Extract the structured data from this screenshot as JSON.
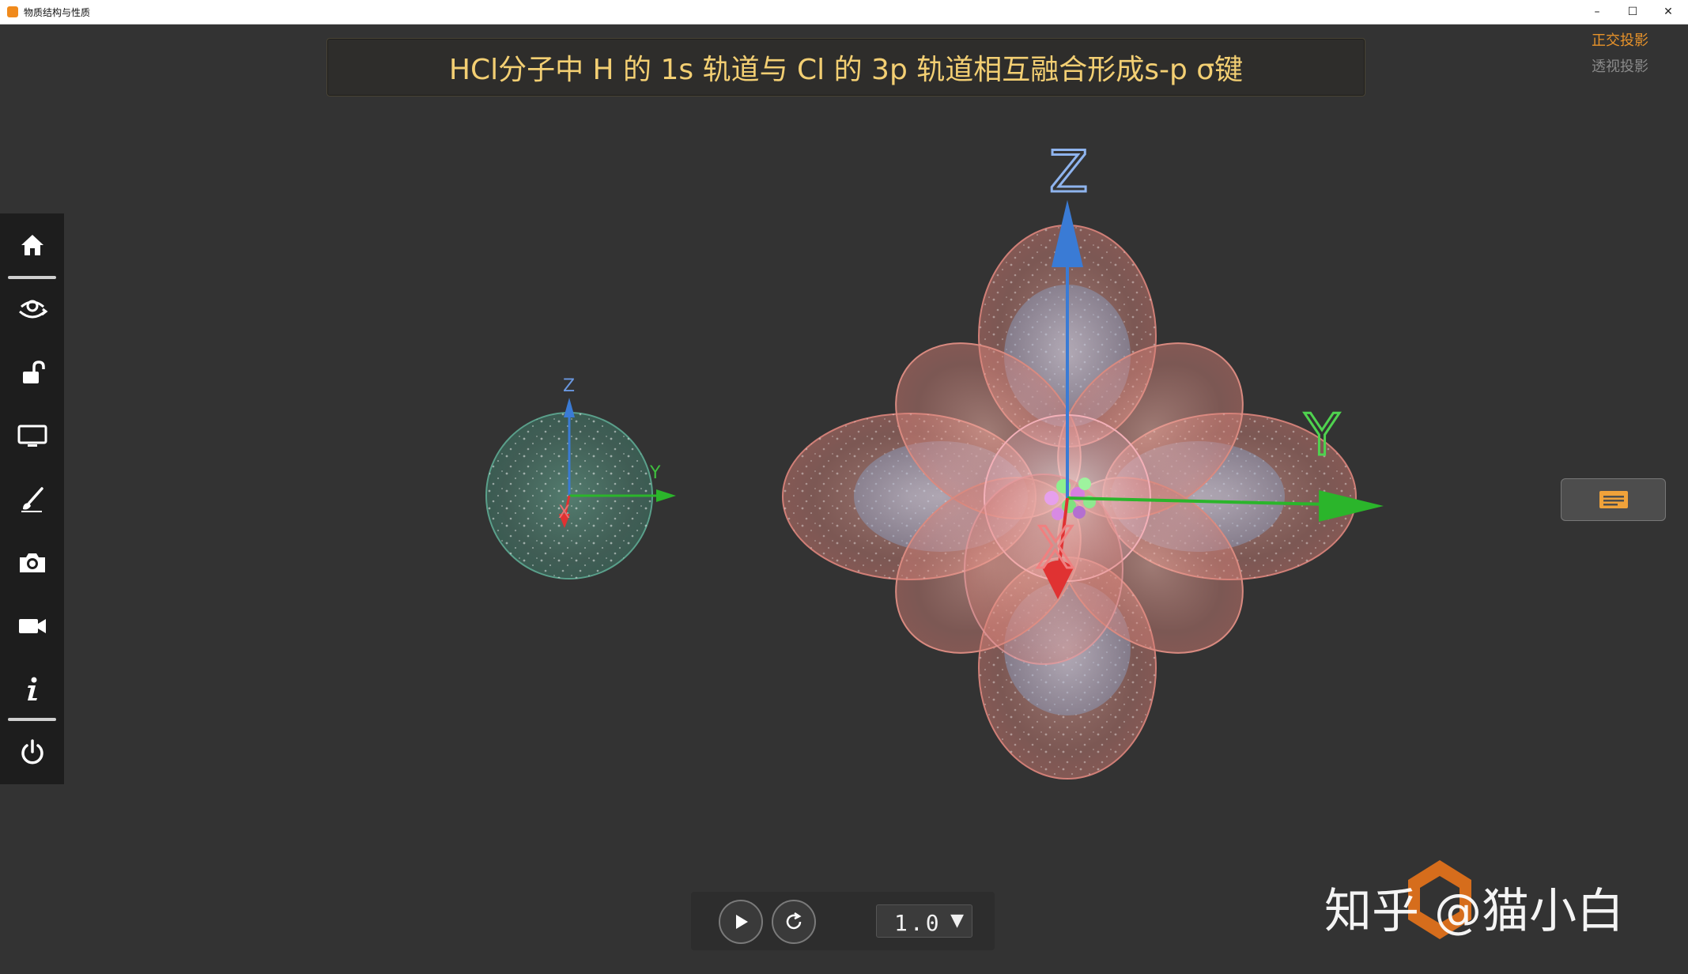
{
  "window": {
    "title": "物质结构与性质",
    "minimize_glyph": "–",
    "maximize_glyph": "☐",
    "close_glyph": "✕"
  },
  "banner": {
    "title": "HCl分子中 H 的 1s 轨道与 Cl 的 3p 轨道相互融合形成s-p σ键"
  },
  "projection": {
    "orthographic": "正交投影",
    "perspective": "透视投影",
    "active_color": "#e8932a",
    "inactive_color": "#8a8a8a"
  },
  "sidebar": {
    "items": [
      {
        "icon": "home-icon"
      },
      {
        "icon": "view-rotate-icon"
      },
      {
        "icon": "unlock-icon"
      },
      {
        "icon": "monitor-icon"
      },
      {
        "icon": "brush-icon"
      },
      {
        "icon": "camera-icon"
      },
      {
        "icon": "video-camera-icon"
      },
      {
        "icon": "info-icon"
      },
      {
        "icon": "power-icon"
      }
    ]
  },
  "scene": {
    "h_atom": {
      "axis_labels": {
        "z": "Z",
        "y": "Y",
        "x": "X"
      },
      "orbital_color": "#5fa68f"
    },
    "cl_atom": {
      "axis_labels": {
        "z": "Z",
        "y": "Y",
        "x": "X"
      },
      "orbital_color": "#e8948a",
      "inner_color": "#9fb6d4"
    },
    "axis_colors": {
      "z": "#3a7bd5",
      "y": "#2bb52b",
      "x": "#e03232"
    }
  },
  "controls": {
    "play_icon": "play-icon",
    "reset_icon": "reset-icon",
    "speed_value": "1.0",
    "speed_arrow": "▼"
  },
  "watermark": {
    "text": "知乎 @猫小白"
  }
}
